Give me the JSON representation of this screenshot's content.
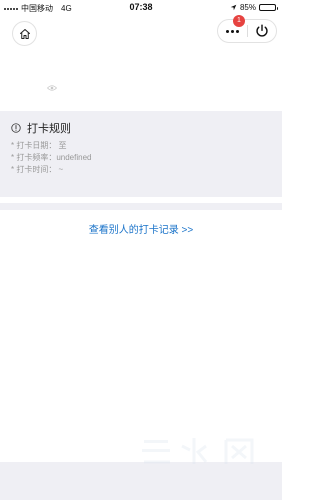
{
  "status_bar": {
    "carrier": "中国移动",
    "network": "4G",
    "time": "07:38",
    "battery": "85%",
    "battery_level": 0.85
  },
  "nav": {
    "home_icon": "home-icon",
    "more_icon": "more-icon",
    "power_icon": "power-icon",
    "notification_count": "1"
  },
  "rules": {
    "title": "打卡规则",
    "items": [
      "* 打卡日期：  至",
      "* 打卡频率：undefined",
      "* 打卡时间：  ~"
    ]
  },
  "link_text": "查看别人的打卡记录 >>",
  "colors": {
    "accent": "#1a73c9",
    "badge": "#e64340",
    "panel_bg": "#efeff4"
  }
}
